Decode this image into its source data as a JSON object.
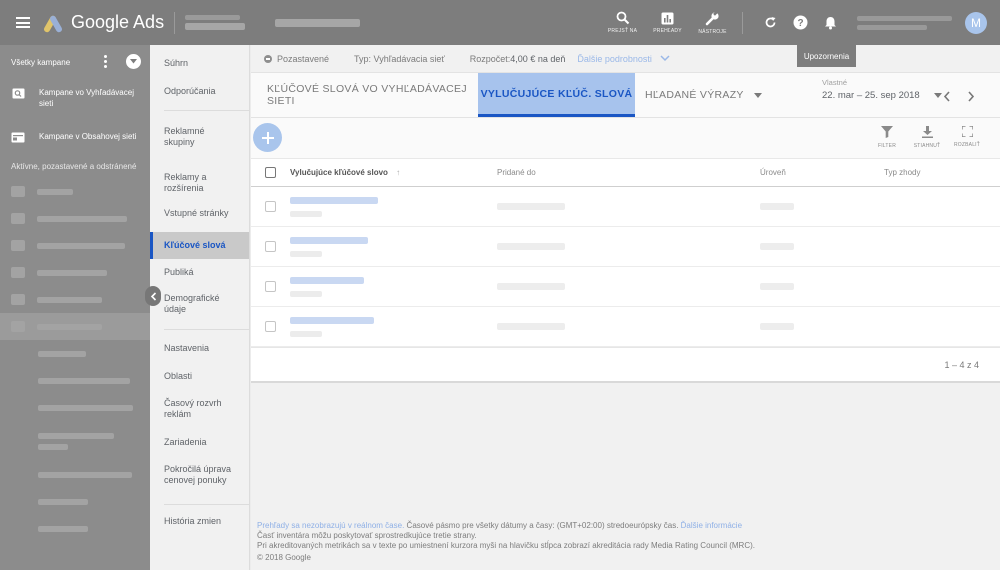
{
  "header": {
    "product_name": "Google Ads",
    "tools": [
      {
        "icon": "search-icon",
        "label": "PREJSŤ NA"
      },
      {
        "icon": "reports-icon",
        "label": "PREHĽADY"
      },
      {
        "icon": "wrench-icon",
        "label": "NÁSTROJE"
      }
    ],
    "avatar_initial": "M",
    "tooltip": "Upozornenia"
  },
  "leftnav": {
    "all_campaigns": "Všetky kampane",
    "search_campaigns": "Kampane vo Vyhľadávacej sieti",
    "display_campaigns": "Kampane v Obsahovej sieti",
    "filter_note": "Aktívne, pozastavené a odstránené"
  },
  "midnav": {
    "items": [
      "Súhrn",
      "Odporúčania",
      "Reklamné skupiny",
      "Reklamy a rozšírenia",
      "Vstupné stránky",
      "Kľúčové slová",
      "Publiká",
      "Demografické údaje",
      "Nastavenia",
      "Oblasti",
      "Časový rozvrh reklám",
      "Zariadenia",
      "Pokročilá úprava cenovej ponuky",
      "História zmien"
    ]
  },
  "status": {
    "state": "Pozastavené",
    "type": "Typ: Vyhľadávacia sieť",
    "budget_label": "Rozpočet: ",
    "budget_value": "4,00 € na deň",
    "more_details": "Ďalšie podrobnosti"
  },
  "tabs": {
    "keywords": "KĽÚČOVÉ SLOVÁ VO VYHĽADÁVACEJ SIETI",
    "negative": "VYLUČUJÚCE KĽÚČ. SLOVÁ",
    "search_terms": "HĽADANÉ VÝRAZY"
  },
  "daterange": {
    "label": "Vlastné",
    "value": "22. mar – 25. sep 2018"
  },
  "toolbar": {
    "filter": "FILTER",
    "download": "STIAHNUŤ",
    "expand": "ROZBALIŤ"
  },
  "table": {
    "headers": [
      "Vylučujúce kľúčové slovo",
      "Pridané do",
      "Úroveň",
      "Typ zhody"
    ],
    "pagination": "1 – 4 z 4"
  },
  "footer": {
    "line1_link": "Prehľady sa nezobrazujú v reálnom čase.",
    "line1_text": " Časové pásmo pre všetky dátumy a časy: (GMT+02:00) stredoeurópsky čas. ",
    "line1_link2": "Ďalšie informácie",
    "line2": "Časť inventára môžu poskytovať sprostredkujúce tretie strany.",
    "line3": "Pri akreditovaných metrikách sa v texte po umiestnení kurzora myši na hlavičku stĺpca zobrazí akreditácia rady Media Rating Council (MRC).",
    "copyright": "© 2018 Google"
  }
}
